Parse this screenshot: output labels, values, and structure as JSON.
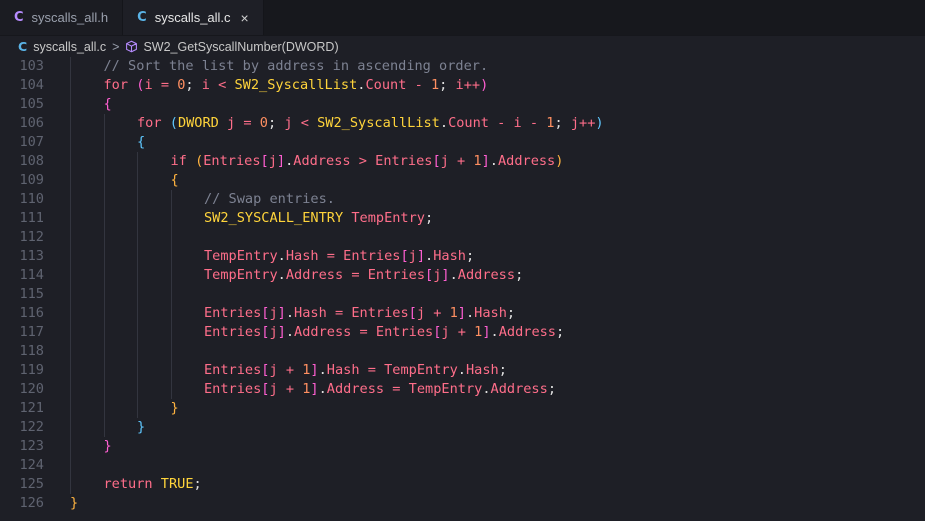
{
  "tabs": [
    {
      "lang": "C",
      "label": "syscalls_all.h",
      "active": false
    },
    {
      "lang": "C",
      "label": "syscalls_all.c",
      "active": true
    }
  ],
  "close_icon": "×",
  "breadcrumb": {
    "lang": "C",
    "file": "syscalls_all.c",
    "separator": ">",
    "symbol": "SW2_GetSyscallNumber(DWORD)",
    "symbol_icon": "cube-icon"
  },
  "code": {
    "lines": [
      {
        "n": "103",
        "indent": 1,
        "tokens": [
          [
            "cm",
            "// Sort the list by address in ascending order."
          ]
        ]
      },
      {
        "n": "104",
        "indent": 1,
        "tokens": [
          [
            "kw",
            "for"
          ],
          [
            "p",
            " "
          ],
          [
            "br1",
            "("
          ],
          [
            "id",
            "i"
          ],
          [
            "p",
            " "
          ],
          [
            "op",
            "="
          ],
          [
            "p",
            " "
          ],
          [
            "num",
            "0"
          ],
          [
            "p",
            "; "
          ],
          [
            "id",
            "i"
          ],
          [
            "p",
            " "
          ],
          [
            "op",
            "<"
          ],
          [
            "p",
            " "
          ],
          [
            "ty",
            "SW2_SyscallList"
          ],
          [
            "p",
            "."
          ],
          [
            "id",
            "Count"
          ],
          [
            "p",
            " "
          ],
          [
            "op",
            "-"
          ],
          [
            "p",
            " "
          ],
          [
            "num",
            "1"
          ],
          [
            "p",
            "; "
          ],
          [
            "id",
            "i"
          ],
          [
            "op",
            "++"
          ],
          [
            "br1",
            ")"
          ]
        ]
      },
      {
        "n": "105",
        "indent": 1,
        "tokens": [
          [
            "br1",
            "{"
          ]
        ]
      },
      {
        "n": "106",
        "indent": 2,
        "tokens": [
          [
            "kw",
            "for"
          ],
          [
            "p",
            " "
          ],
          [
            "br2",
            "("
          ],
          [
            "ty",
            "DWORD"
          ],
          [
            "p",
            " "
          ],
          [
            "id",
            "j"
          ],
          [
            "p",
            " "
          ],
          [
            "op",
            "="
          ],
          [
            "p",
            " "
          ],
          [
            "num",
            "0"
          ],
          [
            "p",
            "; "
          ],
          [
            "id",
            "j"
          ],
          [
            "p",
            " "
          ],
          [
            "op",
            "<"
          ],
          [
            "p",
            " "
          ],
          [
            "ty",
            "SW2_SyscallList"
          ],
          [
            "p",
            "."
          ],
          [
            "id",
            "Count"
          ],
          [
            "p",
            " "
          ],
          [
            "op",
            "-"
          ],
          [
            "p",
            " "
          ],
          [
            "id",
            "i"
          ],
          [
            "p",
            " "
          ],
          [
            "op",
            "-"
          ],
          [
            "p",
            " "
          ],
          [
            "num",
            "1"
          ],
          [
            "p",
            "; "
          ],
          [
            "id",
            "j"
          ],
          [
            "op",
            "++"
          ],
          [
            "br2",
            ")"
          ]
        ]
      },
      {
        "n": "107",
        "indent": 2,
        "tokens": [
          [
            "br2",
            "{"
          ]
        ]
      },
      {
        "n": "108",
        "indent": 3,
        "tokens": [
          [
            "kw",
            "if"
          ],
          [
            "p",
            " "
          ],
          [
            "br3",
            "("
          ],
          [
            "id",
            "Entries"
          ],
          [
            "br1",
            "["
          ],
          [
            "id",
            "j"
          ],
          [
            "br1",
            "]"
          ],
          [
            "p",
            "."
          ],
          [
            "id",
            "Address"
          ],
          [
            "p",
            " "
          ],
          [
            "op",
            ">"
          ],
          [
            "p",
            " "
          ],
          [
            "id",
            "Entries"
          ],
          [
            "br1",
            "["
          ],
          [
            "id",
            "j"
          ],
          [
            "p",
            " "
          ],
          [
            "op",
            "+"
          ],
          [
            "p",
            " "
          ],
          [
            "num",
            "1"
          ],
          [
            "br1",
            "]"
          ],
          [
            "p",
            "."
          ],
          [
            "id",
            "Address"
          ],
          [
            "br3",
            ")"
          ]
        ]
      },
      {
        "n": "109",
        "indent": 3,
        "tokens": [
          [
            "br3",
            "{"
          ]
        ]
      },
      {
        "n": "110",
        "indent": 4,
        "tokens": [
          [
            "cm",
            "// Swap entries."
          ]
        ]
      },
      {
        "n": "111",
        "indent": 4,
        "tokens": [
          [
            "ty",
            "SW2_SYSCALL_ENTRY"
          ],
          [
            "p",
            " "
          ],
          [
            "id",
            "TempEntry"
          ],
          [
            "p",
            ";"
          ]
        ]
      },
      {
        "n": "112",
        "indent": 4,
        "tokens": []
      },
      {
        "n": "113",
        "indent": 4,
        "tokens": [
          [
            "id",
            "TempEntry"
          ],
          [
            "p",
            "."
          ],
          [
            "id",
            "Hash"
          ],
          [
            "p",
            " "
          ],
          [
            "op",
            "="
          ],
          [
            "p",
            " "
          ],
          [
            "id",
            "Entries"
          ],
          [
            "br1",
            "["
          ],
          [
            "id",
            "j"
          ],
          [
            "br1",
            "]"
          ],
          [
            "p",
            "."
          ],
          [
            "id",
            "Hash"
          ],
          [
            "p",
            ";"
          ]
        ]
      },
      {
        "n": "114",
        "indent": 4,
        "tokens": [
          [
            "id",
            "TempEntry"
          ],
          [
            "p",
            "."
          ],
          [
            "id",
            "Address"
          ],
          [
            "p",
            " "
          ],
          [
            "op",
            "="
          ],
          [
            "p",
            " "
          ],
          [
            "id",
            "Entries"
          ],
          [
            "br1",
            "["
          ],
          [
            "id",
            "j"
          ],
          [
            "br1",
            "]"
          ],
          [
            "p",
            "."
          ],
          [
            "id",
            "Address"
          ],
          [
            "p",
            ";"
          ]
        ]
      },
      {
        "n": "115",
        "indent": 4,
        "tokens": []
      },
      {
        "n": "116",
        "indent": 4,
        "tokens": [
          [
            "id",
            "Entries"
          ],
          [
            "br1",
            "["
          ],
          [
            "id",
            "j"
          ],
          [
            "br1",
            "]"
          ],
          [
            "p",
            "."
          ],
          [
            "id",
            "Hash"
          ],
          [
            "p",
            " "
          ],
          [
            "op",
            "="
          ],
          [
            "p",
            " "
          ],
          [
            "id",
            "Entries"
          ],
          [
            "br1",
            "["
          ],
          [
            "id",
            "j"
          ],
          [
            "p",
            " "
          ],
          [
            "op",
            "+"
          ],
          [
            "p",
            " "
          ],
          [
            "num",
            "1"
          ],
          [
            "br1",
            "]"
          ],
          [
            "p",
            "."
          ],
          [
            "id",
            "Hash"
          ],
          [
            "p",
            ";"
          ]
        ]
      },
      {
        "n": "117",
        "indent": 4,
        "tokens": [
          [
            "id",
            "Entries"
          ],
          [
            "br1",
            "["
          ],
          [
            "id",
            "j"
          ],
          [
            "br1",
            "]"
          ],
          [
            "p",
            "."
          ],
          [
            "id",
            "Address"
          ],
          [
            "p",
            " "
          ],
          [
            "op",
            "="
          ],
          [
            "p",
            " "
          ],
          [
            "id",
            "Entries"
          ],
          [
            "br1",
            "["
          ],
          [
            "id",
            "j"
          ],
          [
            "p",
            " "
          ],
          [
            "op",
            "+"
          ],
          [
            "p",
            " "
          ],
          [
            "num",
            "1"
          ],
          [
            "br1",
            "]"
          ],
          [
            "p",
            "."
          ],
          [
            "id",
            "Address"
          ],
          [
            "p",
            ";"
          ]
        ]
      },
      {
        "n": "118",
        "indent": 4,
        "tokens": []
      },
      {
        "n": "119",
        "indent": 4,
        "tokens": [
          [
            "id",
            "Entries"
          ],
          [
            "br1",
            "["
          ],
          [
            "id",
            "j"
          ],
          [
            "p",
            " "
          ],
          [
            "op",
            "+"
          ],
          [
            "p",
            " "
          ],
          [
            "num",
            "1"
          ],
          [
            "br1",
            "]"
          ],
          [
            "p",
            "."
          ],
          [
            "id",
            "Hash"
          ],
          [
            "p",
            " "
          ],
          [
            "op",
            "="
          ],
          [
            "p",
            " "
          ],
          [
            "id",
            "TempEntry"
          ],
          [
            "p",
            "."
          ],
          [
            "id",
            "Hash"
          ],
          [
            "p",
            ";"
          ]
        ]
      },
      {
        "n": "120",
        "indent": 4,
        "tokens": [
          [
            "id",
            "Entries"
          ],
          [
            "br1",
            "["
          ],
          [
            "id",
            "j"
          ],
          [
            "p",
            " "
          ],
          [
            "op",
            "+"
          ],
          [
            "p",
            " "
          ],
          [
            "num",
            "1"
          ],
          [
            "br1",
            "]"
          ],
          [
            "p",
            "."
          ],
          [
            "id",
            "Address"
          ],
          [
            "p",
            " "
          ],
          [
            "op",
            "="
          ],
          [
            "p",
            " "
          ],
          [
            "id",
            "TempEntry"
          ],
          [
            "p",
            "."
          ],
          [
            "id",
            "Address"
          ],
          [
            "p",
            ";"
          ]
        ]
      },
      {
        "n": "121",
        "indent": 3,
        "tokens": [
          [
            "br3",
            "}"
          ]
        ]
      },
      {
        "n": "122",
        "indent": 2,
        "tokens": [
          [
            "br2",
            "}"
          ]
        ]
      },
      {
        "n": "123",
        "indent": 1,
        "tokens": [
          [
            "br1",
            "}"
          ]
        ]
      },
      {
        "n": "124",
        "indent": 1,
        "tokens": []
      },
      {
        "n": "125",
        "indent": 1,
        "tokens": [
          [
            "kw",
            "return"
          ],
          [
            "p",
            " "
          ],
          [
            "ty",
            "TRUE"
          ],
          [
            "p",
            ";"
          ]
        ]
      },
      {
        "n": "126",
        "indent": 0,
        "tokens": [
          [
            "br3",
            "}"
          ]
        ]
      }
    ]
  }
}
